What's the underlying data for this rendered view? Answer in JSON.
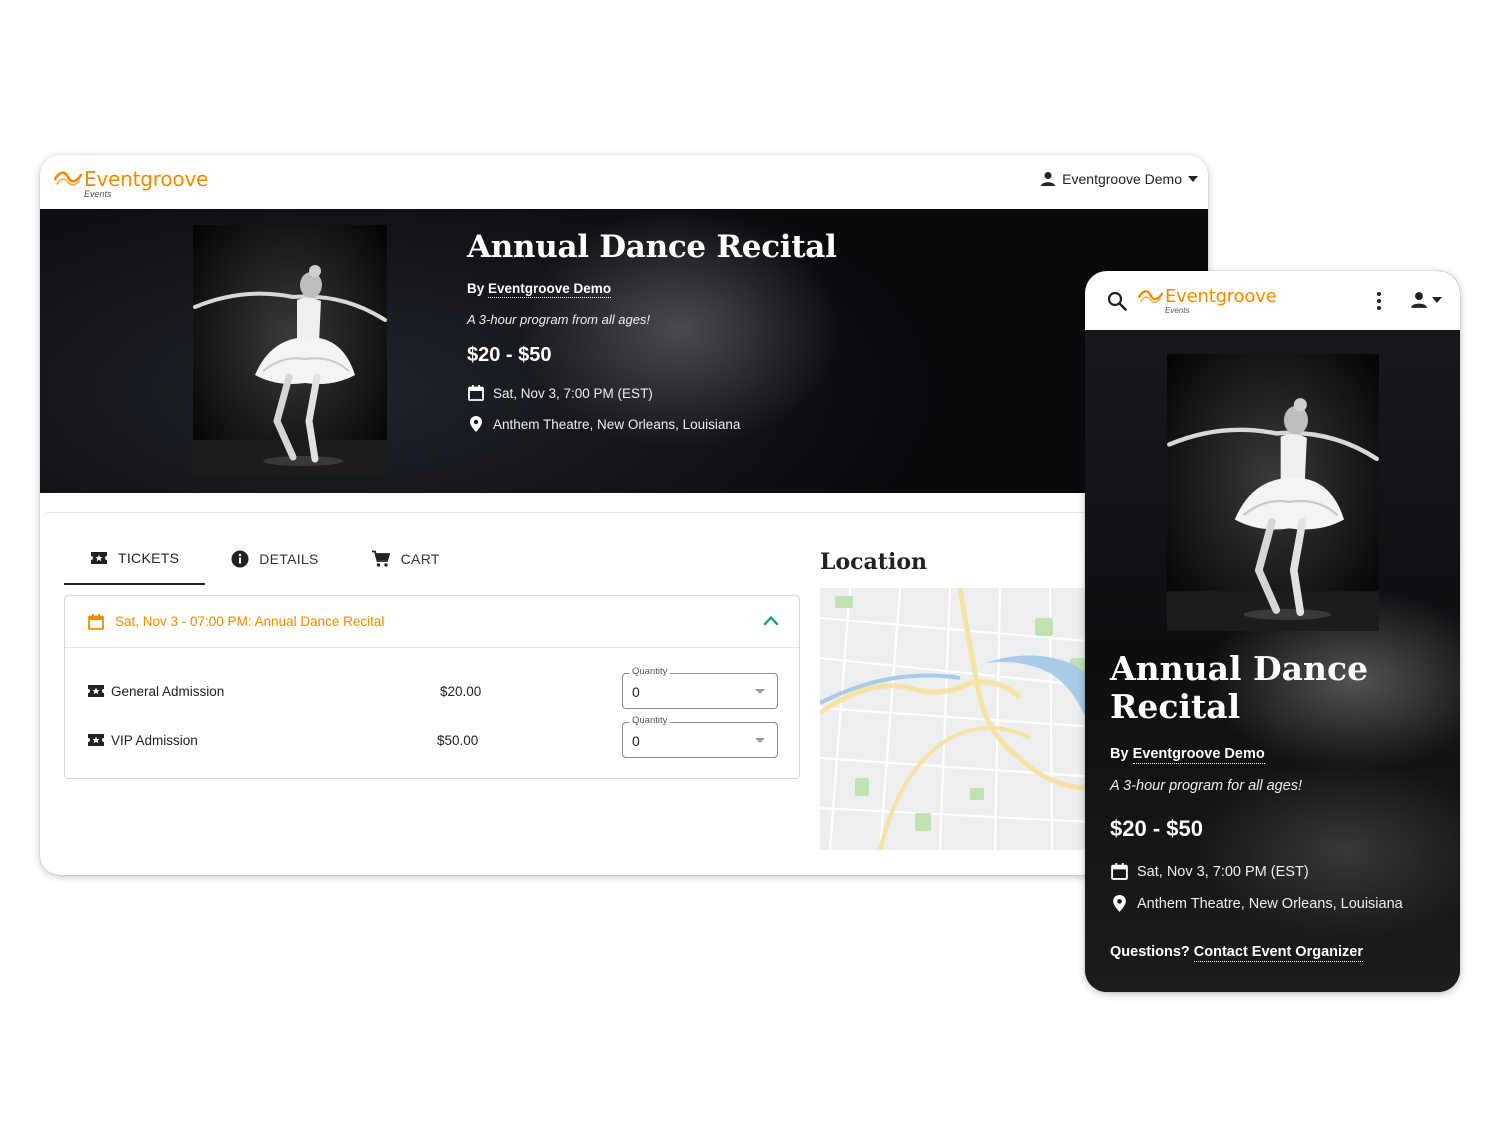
{
  "brand": {
    "name": "Eventgroove",
    "sub": "Events",
    "color": "#f08a00"
  },
  "desktop": {
    "user_menu_label": "Eventgroove Demo",
    "event": {
      "title": "Annual Dance Recital",
      "by_prefix": "By",
      "organizer": "Eventgroove Demo",
      "tagline": "A 3-hour program from all ages!",
      "price_range": "$20 - $50",
      "date": "Sat, Nov 3, 7:00 PM (EST)",
      "venue": "Anthem Theatre, New Orleans, Louisiana"
    },
    "tabs": [
      {
        "label": "TICKETS",
        "icon": "ticket-icon",
        "active": true
      },
      {
        "label": "DETAILS",
        "icon": "info-icon",
        "active": false
      },
      {
        "label": "CART",
        "icon": "cart-icon",
        "active": false
      }
    ],
    "session": {
      "label": "Sat, Nov 3 - 07:00 PM: Annual Dance Recital",
      "expanded": true
    },
    "tickets": [
      {
        "name": "General Admission",
        "price": "$20.00",
        "quantity_label": "Quantity",
        "quantity": "0"
      },
      {
        "name": "VIP Admission",
        "price": "$50.00",
        "quantity_label": "Quantity",
        "quantity": "0"
      }
    ],
    "location_title": "Location"
  },
  "mobile": {
    "event": {
      "title": "Annual Dance Recital",
      "by_prefix": "By",
      "organizer": "Eventgroove Demo",
      "tagline": "A 3-hour program for all ages!",
      "price_range": "$20 - $50",
      "date": "Sat, Nov 3, 7:00 PM (EST)",
      "venue": "Anthem Theatre, New Orleans, Louisiana"
    },
    "questions_prefix": "Questions?",
    "contact_link": "Contact Event Organizer"
  },
  "colors": {
    "accent": "#f08a00",
    "chevron": "#1aa37a",
    "hero_dark": "#0b0b0e"
  }
}
